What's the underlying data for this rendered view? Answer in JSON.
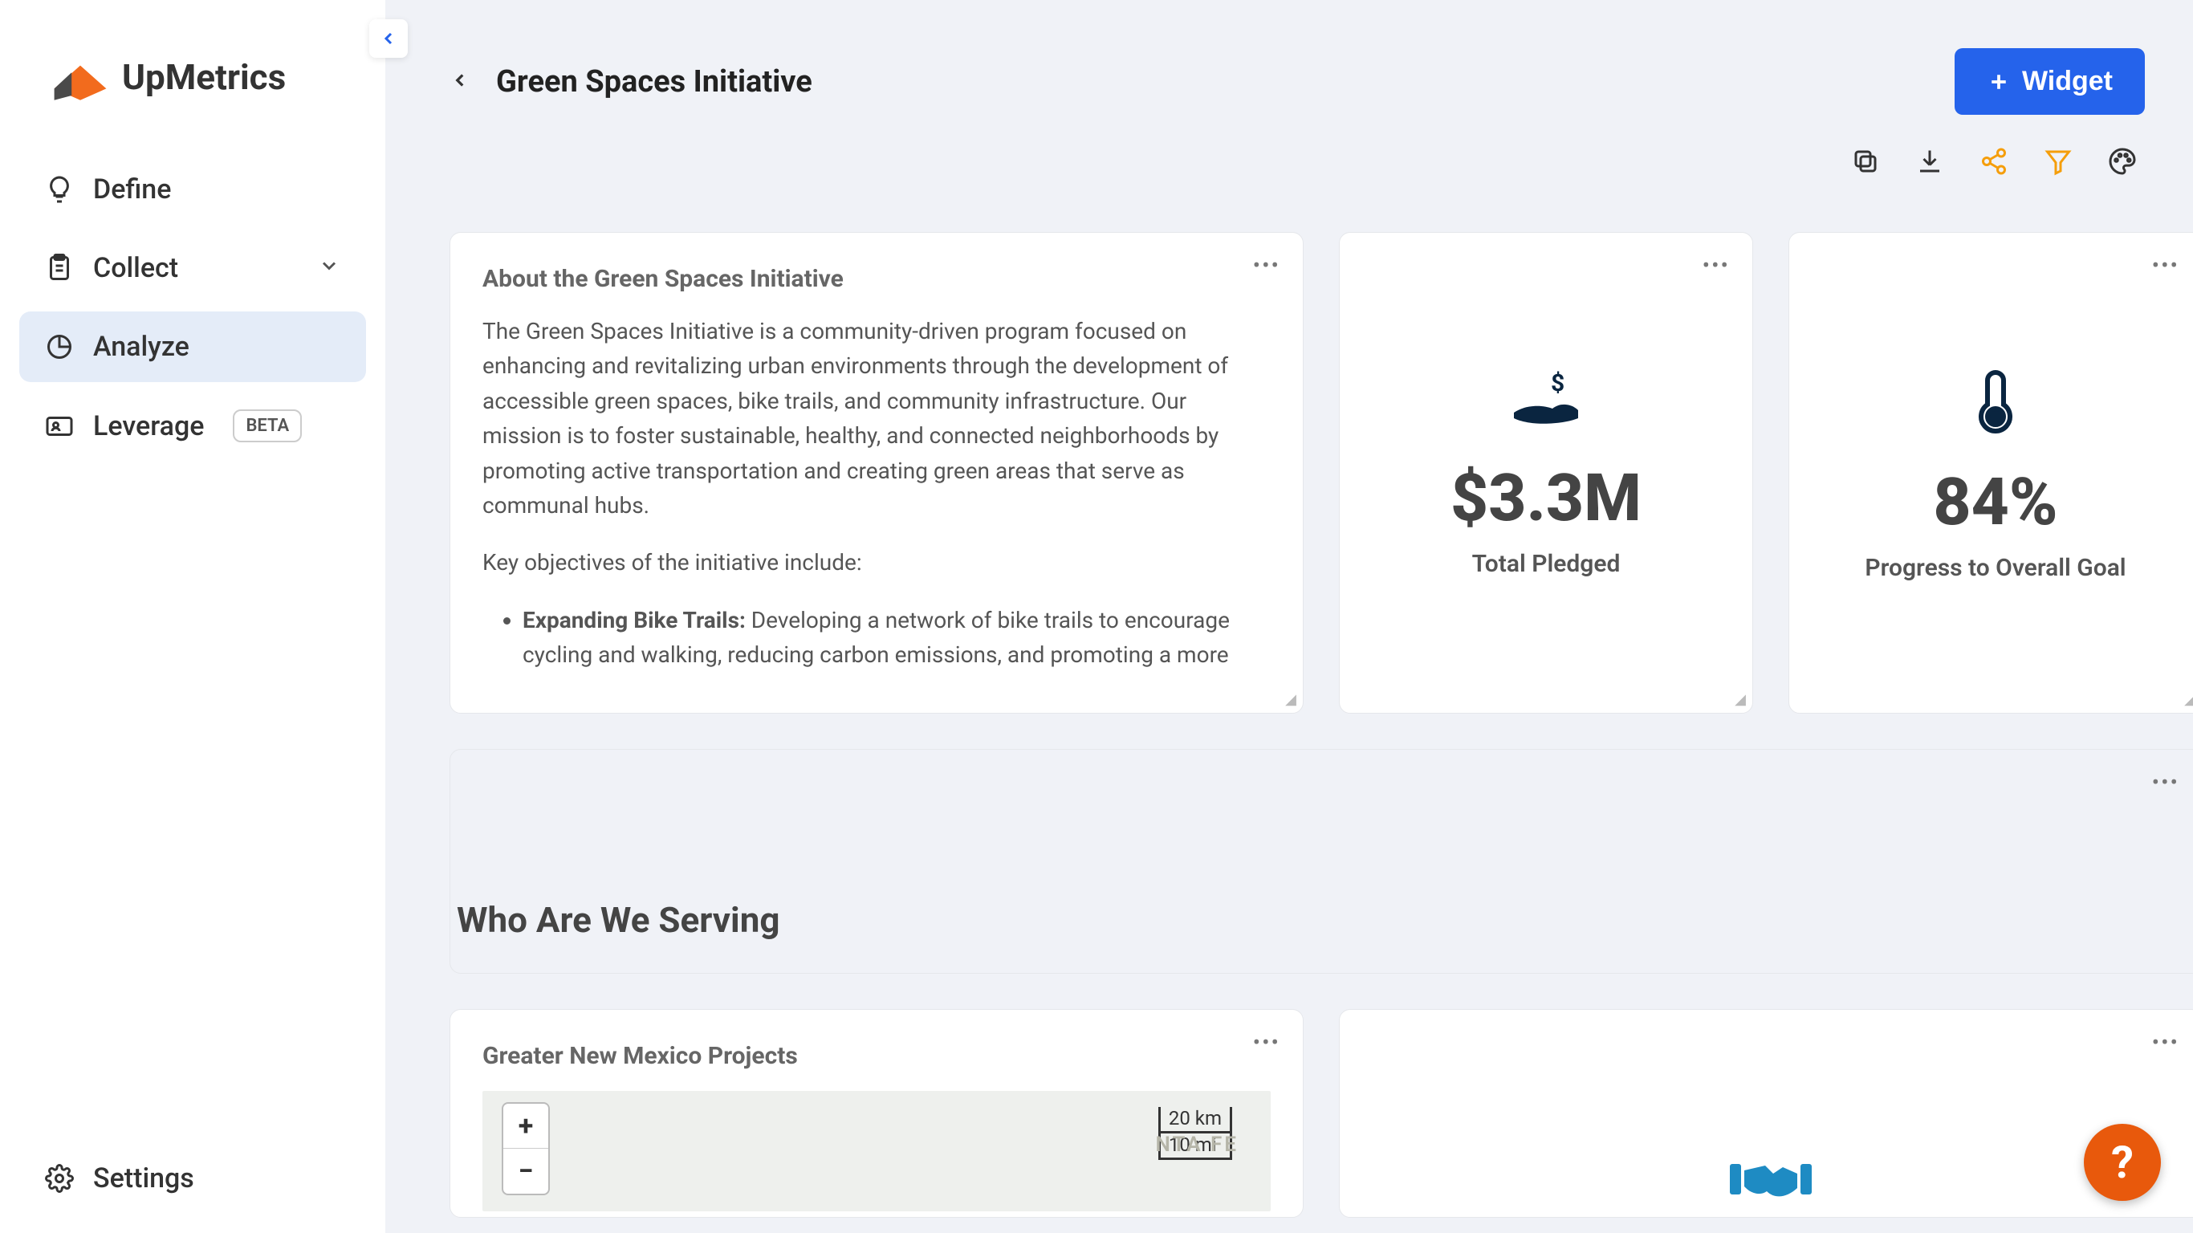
{
  "brand": {
    "name": "UpMetrics"
  },
  "sidebar": {
    "items": [
      {
        "label": "Define"
      },
      {
        "label": "Collect"
      },
      {
        "label": "Analyze"
      },
      {
        "label": "Leverage",
        "badge": "BETA"
      }
    ],
    "settings_label": "Settings"
  },
  "header": {
    "title": "Green Spaces Initiative",
    "widget_button": "Widget"
  },
  "about": {
    "title": "About the Green Spaces Initiative",
    "paragraph": "The Green Spaces Initiative is a community-driven program focused on enhancing and revitalizing urban environments through the development of accessible green spaces, bike trails, and community infrastructure. Our mission is to foster sustainable, healthy, and connected neighborhoods by promoting active transportation and creating green areas that serve as communal hubs.",
    "objectives_intro": "Key objectives of the initiative include:",
    "objective1_title": "Expanding Bike Trails:",
    "objective1_text": " Developing a network of bike trails to encourage cycling and walking, reducing carbon emissions, and promoting a more"
  },
  "stat_pledged": {
    "value": "$3.3M",
    "label": "Total Pledged"
  },
  "stat_progress": {
    "value": "84%",
    "label": "Progress to Overall Goal"
  },
  "serving": {
    "title": "Who Are We Serving"
  },
  "map_card": {
    "title": "Greater New Mexico Projects",
    "scale_km": "20 km",
    "scale_mi": "10 mi",
    "city_label": "NTA FE"
  },
  "help": {
    "symbol": "?"
  }
}
